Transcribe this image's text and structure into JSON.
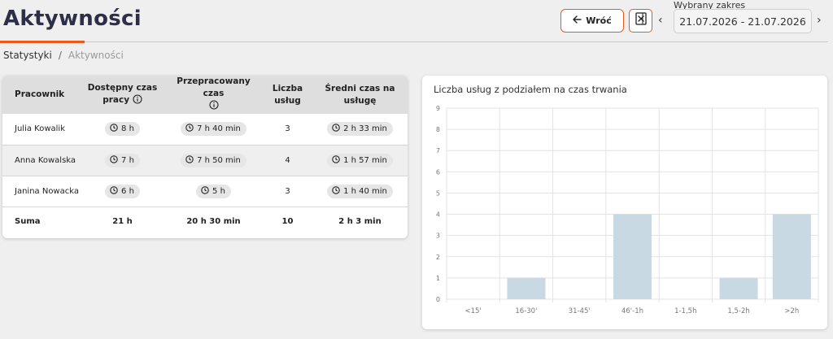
{
  "header": {
    "title": "Aktywności",
    "back_label": "Wróć",
    "range_label": "Wybrany zakres",
    "range_value": "21.07.2026 - 21.07.2026",
    "prev_glyph": "‹",
    "next_glyph": "›"
  },
  "breadcrumb": {
    "root": "Statystyki",
    "separator": "/",
    "current": "Aktywności"
  },
  "table": {
    "headers": {
      "employee": "Pracownik",
      "available": "Dostępny czas pracy",
      "worked": "Przepracowany czas",
      "count": "Liczba usług",
      "average": "Średni czas na usługę"
    },
    "rows": [
      {
        "employee": "Julia Kowalik",
        "available": "8 h",
        "worked": "7 h 40 min",
        "count": "3",
        "average": "2 h 33 min"
      },
      {
        "employee": "Anna Kowalska",
        "available": "7 h",
        "worked": "7 h 50 min",
        "count": "4",
        "average": "1 h 57 min"
      },
      {
        "employee": "Janina Nowacka",
        "available": "6 h",
        "worked": "5 h",
        "count": "3",
        "average": "1 h 40 min"
      }
    ],
    "total": {
      "employee": "Suma",
      "available": "21 h",
      "worked": "20 h 30 min",
      "count": "10",
      "average": "2 h 3 min"
    }
  },
  "chart_data": {
    "type": "bar",
    "title": "Liczba usług z podziałem na czas trwania",
    "categories": [
      "<15'",
      "16-30'",
      "31-45'",
      "46'-1h",
      "1-1,5h",
      "1,5-2h",
      ">2h"
    ],
    "values": [
      0,
      1,
      0,
      4,
      0,
      1,
      4
    ],
    "ylim": [
      0,
      9
    ],
    "yticks": [
      0,
      1,
      2,
      3,
      4,
      5,
      6,
      7,
      8,
      9
    ],
    "grid": true,
    "legend": "none",
    "bar_color": "#c8d9e3"
  },
  "colors": {
    "accent": "#e8591a",
    "title": "#2c2f45"
  }
}
